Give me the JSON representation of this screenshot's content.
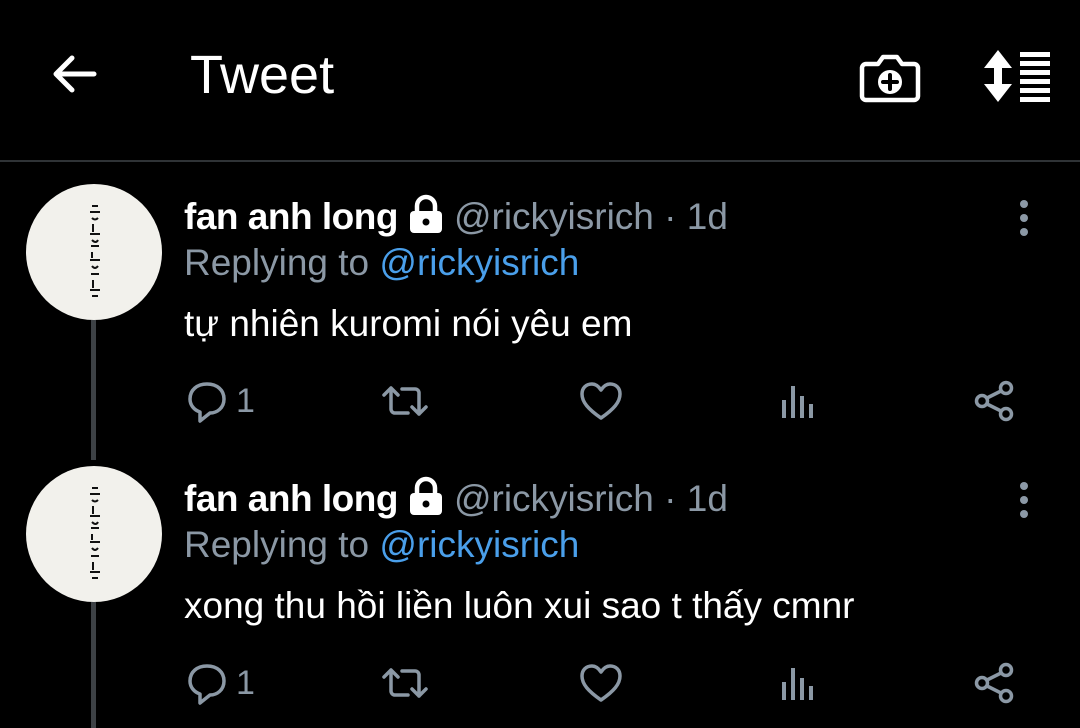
{
  "header": {
    "title": "Tweet"
  },
  "tweets": [
    {
      "author_name": "fan anh long",
      "author_handle": "@rickyisrich",
      "separator": "·",
      "time": "1d",
      "replying_prefix": "Replying to",
      "replying_to": "@rickyisrich",
      "text": "tự nhiên kuromi nói yêu em",
      "reply_count": "1"
    },
    {
      "author_name": "fan anh long",
      "author_handle": "@rickyisrich",
      "separator": "·",
      "time": "1d",
      "replying_prefix": "Replying to",
      "replying_to": "@rickyisrich",
      "text": "xong thu hồi liền luôn xui sao t thấy cmnr",
      "reply_count": "1"
    }
  ],
  "icons": {
    "back": "arrow-left-icon",
    "camera": "camera-plus-icon",
    "sort": "sort-icon",
    "lock": "lock-icon",
    "more": "more-vertical-icon",
    "reply": "reply-icon",
    "retweet": "retweet-icon",
    "like": "heart-icon",
    "stats": "analytics-icon",
    "share": "share-icon"
  },
  "colors": {
    "background": "#000000",
    "text": "#ffffff",
    "secondary": "#8b98a5",
    "mention": "#4a9fea",
    "divider": "#2f3336"
  }
}
